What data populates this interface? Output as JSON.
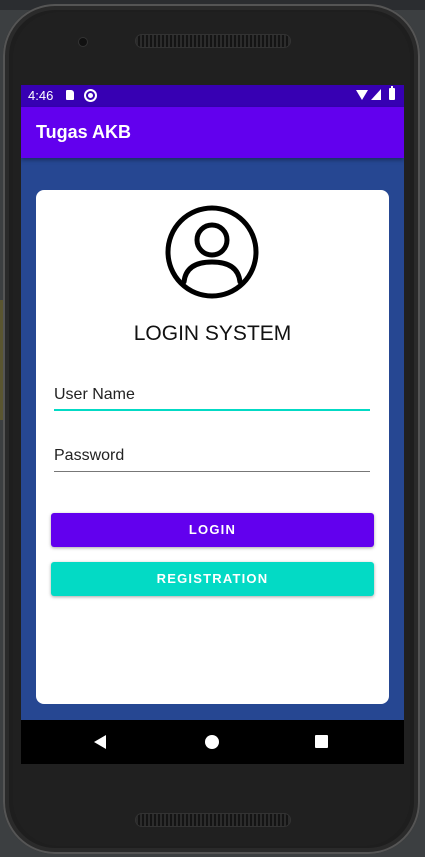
{
  "status_bar": {
    "time": "4:46",
    "icons": [
      "sd-card-icon",
      "sync-icon",
      "wifi-icon",
      "signal-icon",
      "battery-icon"
    ]
  },
  "app_bar": {
    "title": "Tugas AKB",
    "color": "#6200ee"
  },
  "status_bar_color": "#3700b3",
  "background_color": "#264792",
  "card": {
    "avatar_icon": "user-account-icon",
    "heading": "LOGIN SYSTEM",
    "username_placeholder": "User Name",
    "password_placeholder": "Password",
    "login_label": "LOGIN",
    "register_label": "REGISTRATION",
    "login_color": "#6200ee",
    "register_color": "#03dac5"
  },
  "nav_bar": {
    "icons": [
      "back-icon",
      "home-icon",
      "recents-icon"
    ]
  }
}
